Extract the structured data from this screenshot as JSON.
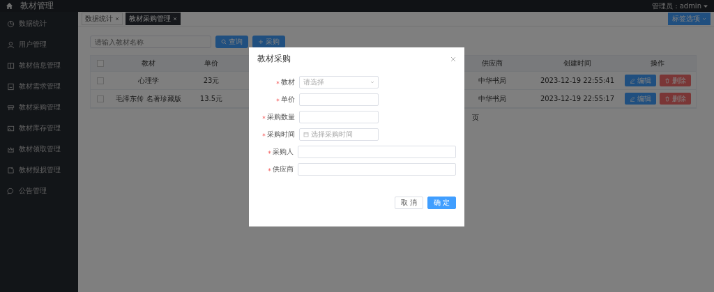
{
  "header": {
    "title": "教材管理",
    "user": "管理员：admin"
  },
  "sidebar": {
    "items": [
      {
        "label": "数据统计"
      },
      {
        "label": "用户管理"
      },
      {
        "label": "教材信息管理"
      },
      {
        "label": "教材需求管理"
      },
      {
        "label": "教材采购管理"
      },
      {
        "label": "教材库存管理"
      },
      {
        "label": "教材领取管理"
      },
      {
        "label": "教材报损管理"
      },
      {
        "label": "公告管理"
      }
    ]
  },
  "tabs": [
    {
      "label": "数据统计",
      "selected": false
    },
    {
      "label": "教材采购管理",
      "selected": true
    }
  ],
  "tab_options": "标签选项",
  "toolbar": {
    "search_placeholder": "请输入教材名称",
    "search_button": "查询",
    "add_button": "采购"
  },
  "table": {
    "header_checked": false,
    "columns": [
      "教材",
      "单价",
      "供应商",
      "创建时间",
      "操作"
    ],
    "rows": [
      {
        "cells": [
          "心理学",
          "23元",
          "中华书局",
          "2023-12-19 22:55:41"
        ],
        "checked": false,
        "edit": "编辑",
        "delete": "删除"
      },
      {
        "cells": [
          "毛泽东传 名著珍藏版",
          "13.5元",
          "中华书局",
          "2023-12-19 22:55:17"
        ],
        "checked": false,
        "edit": "编辑",
        "delete": "删除"
      }
    ]
  },
  "pagination": {
    "text_fragment": "页"
  },
  "dialog": {
    "title": "教材采购",
    "fields": [
      {
        "label": "教材",
        "kind": "select",
        "placeholder": "请选择",
        "required": true,
        "wide": false
      },
      {
        "label": "单价",
        "kind": "input",
        "required": true,
        "wide": false
      },
      {
        "label": "采购数量",
        "kind": "input",
        "required": true,
        "wide": false
      },
      {
        "label": "采购时间",
        "kind": "date",
        "placeholder": "选择采购时间",
        "required": true,
        "wide": false
      },
      {
        "label": "采购人",
        "kind": "input",
        "required": true,
        "wide": true
      },
      {
        "label": "供应商",
        "kind": "input",
        "required": true,
        "wide": true
      }
    ],
    "cancel": "取 消",
    "confirm": "确 定"
  }
}
